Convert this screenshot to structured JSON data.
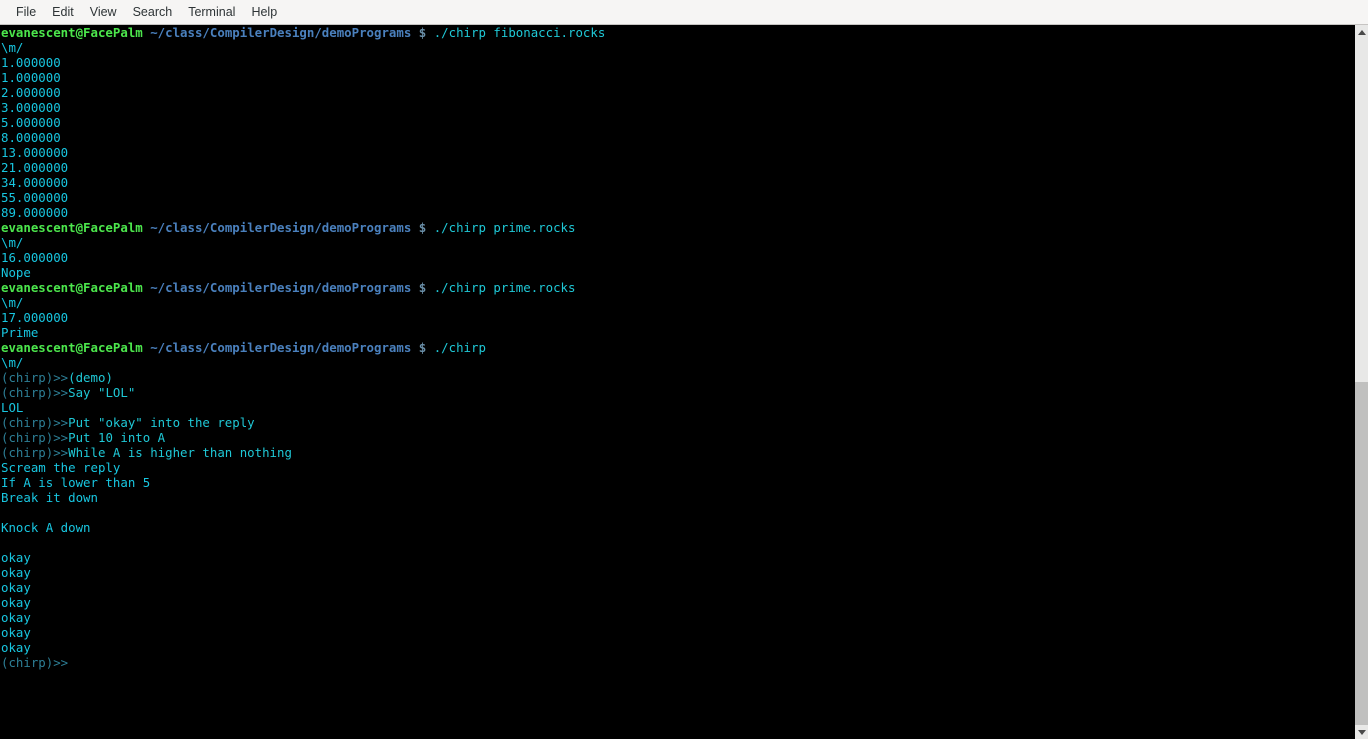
{
  "window": {
    "title": "evanescent@FacePalm: ~/class/CompilerDesign/demoPrograms"
  },
  "menubar": {
    "items": [
      {
        "label": "File"
      },
      {
        "label": "Edit"
      },
      {
        "label": "View"
      },
      {
        "label": "Search"
      },
      {
        "label": "Terminal"
      },
      {
        "label": "Help"
      }
    ]
  },
  "colors": {
    "background": "#000000",
    "user_green": "#4ce64c",
    "path_blue": "#4a80bd",
    "dollar_grey": "#6a8fa8",
    "command_cyan": "#1fc8d6",
    "output_cyan": "#18c6e0",
    "prompt_dim": "#2d7f96",
    "menubar_bg": "#f6f5f4",
    "menubar_fg": "#2e3436",
    "scrollbar_track": "#e8e8e7",
    "scrollbar_thumb": "#c0c0bf"
  },
  "shell": {
    "user_host": "evanescent@FacePalm",
    "cwd": "~/class/CompilerDesign/demoPrograms",
    "dollar": "$",
    "repl_prompt": "(chirp)>>"
  },
  "lines": [
    {
      "type": "prompt",
      "command": "./chirp fibonacci.rocks"
    },
    {
      "type": "out",
      "text": "\\m/"
    },
    {
      "type": "out",
      "text": "1.000000"
    },
    {
      "type": "out",
      "text": "1.000000"
    },
    {
      "type": "out",
      "text": "2.000000"
    },
    {
      "type": "out",
      "text": "3.000000"
    },
    {
      "type": "out",
      "text": "5.000000"
    },
    {
      "type": "out",
      "text": "8.000000"
    },
    {
      "type": "out",
      "text": "13.000000"
    },
    {
      "type": "out",
      "text": "21.000000"
    },
    {
      "type": "out",
      "text": "34.000000"
    },
    {
      "type": "out",
      "text": "55.000000"
    },
    {
      "type": "out",
      "text": "89.000000"
    },
    {
      "type": "prompt",
      "command": "./chirp prime.rocks"
    },
    {
      "type": "out",
      "text": "\\m/"
    },
    {
      "type": "out",
      "text": "16.000000"
    },
    {
      "type": "out",
      "text": "Nope"
    },
    {
      "type": "prompt",
      "command": "./chirp prime.rocks"
    },
    {
      "type": "out",
      "text": "\\m/"
    },
    {
      "type": "out",
      "text": "17.000000"
    },
    {
      "type": "out",
      "text": "Prime"
    },
    {
      "type": "prompt",
      "command": "./chirp"
    },
    {
      "type": "out",
      "text": "\\m/"
    },
    {
      "type": "repl",
      "command": "(demo)"
    },
    {
      "type": "repl",
      "command": "Say \"LOL\""
    },
    {
      "type": "out",
      "text": "LOL"
    },
    {
      "type": "repl",
      "command": "Put \"okay\" into the reply"
    },
    {
      "type": "repl",
      "command": "Put 10 into A"
    },
    {
      "type": "repl",
      "command": "While A is higher than nothing"
    },
    {
      "type": "out",
      "text": "Scream the reply"
    },
    {
      "type": "out",
      "text": "If A is lower than 5"
    },
    {
      "type": "out",
      "text": "Break it down"
    },
    {
      "type": "blank",
      "text": ""
    },
    {
      "type": "out",
      "text": "Knock A down"
    },
    {
      "type": "blank",
      "text": ""
    },
    {
      "type": "out",
      "text": "okay"
    },
    {
      "type": "out",
      "text": "okay"
    },
    {
      "type": "out",
      "text": "okay"
    },
    {
      "type": "out",
      "text": "okay"
    },
    {
      "type": "out",
      "text": "okay"
    },
    {
      "type": "out",
      "text": "okay"
    },
    {
      "type": "out",
      "text": "okay"
    },
    {
      "type": "repl",
      "command": ""
    }
  ],
  "scrollbar": {
    "up_arrow": "chevron-up",
    "down_arrow": "chevron-down",
    "thumb_top_pct": 50,
    "thumb_height_pct": 50
  }
}
